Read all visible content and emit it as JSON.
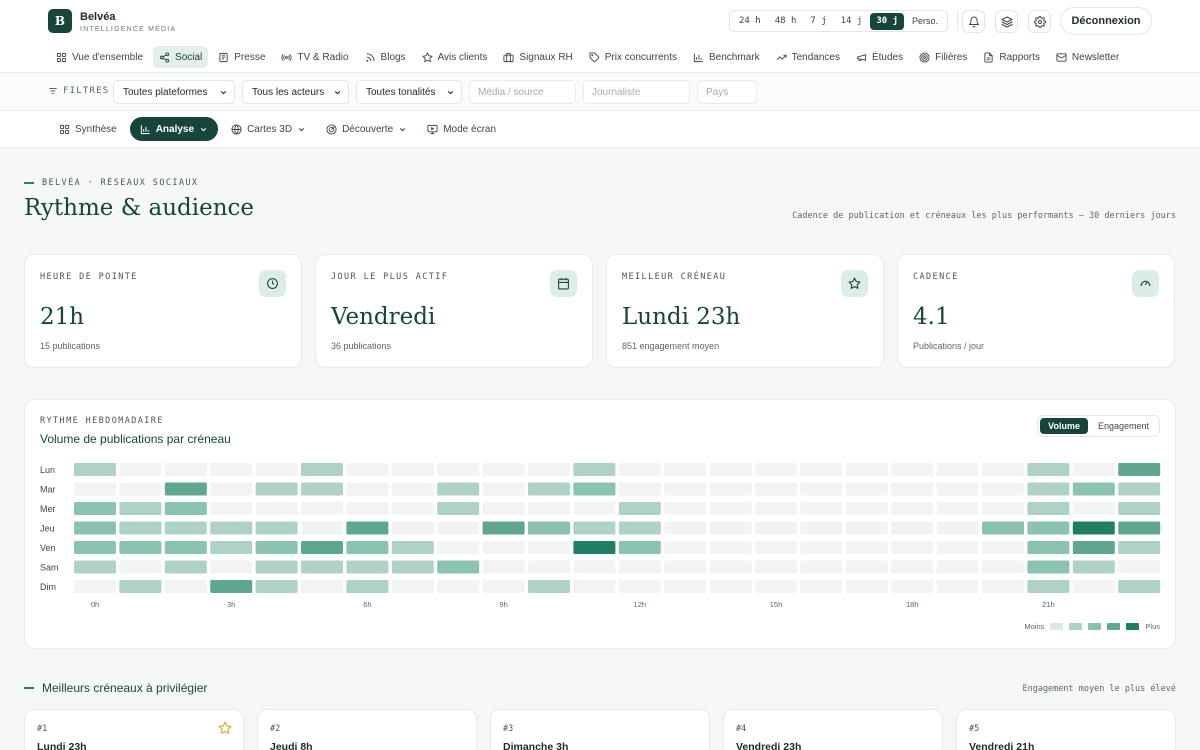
{
  "brand": {
    "logo_letter": "B",
    "name": "Belvéa",
    "tagline": "INTELLIGENCE MÉDIA"
  },
  "time_ranges": [
    {
      "label": "24 h",
      "active": false
    },
    {
      "label": "48 h",
      "active": false
    },
    {
      "label": "7 j",
      "active": false
    },
    {
      "label": "14 j",
      "active": false
    },
    {
      "label": "30 j",
      "active": true
    },
    {
      "label": "Perso.",
      "active": false
    }
  ],
  "header_actions": {
    "logout_label": "Déconnexion"
  },
  "nav": [
    {
      "label": "Vue d'ensemble",
      "icon": "grid-icon",
      "active": false
    },
    {
      "label": "Social",
      "icon": "share-icon",
      "active": true
    },
    {
      "label": "Presse",
      "icon": "newspaper-icon",
      "active": false
    },
    {
      "label": "TV & Radio",
      "icon": "broadcast-icon",
      "active": false
    },
    {
      "label": "Blogs",
      "icon": "rss-icon",
      "active": false
    },
    {
      "label": "Avis clients",
      "icon": "star-icon",
      "active": false
    },
    {
      "label": "Signaux RH",
      "icon": "briefcase-icon",
      "active": false
    },
    {
      "label": "Prix concurrents",
      "icon": "tag-icon",
      "active": false
    },
    {
      "label": "Benchmark",
      "icon": "bar-chart-icon",
      "active": false
    },
    {
      "label": "Tendances",
      "icon": "trend-icon",
      "active": false
    },
    {
      "label": "Études",
      "icon": "megaphone-icon",
      "active": false
    },
    {
      "label": "Filières",
      "icon": "target-icon",
      "active": false
    },
    {
      "label": "Rapports",
      "icon": "file-icon",
      "active": false
    },
    {
      "label": "Newsletter",
      "icon": "mail-icon",
      "active": false
    }
  ],
  "filters": {
    "label": "FILTRES",
    "platform": "Toutes plateformes",
    "actors": "Tous les acteurs",
    "tone": "Toutes tonalités",
    "media_placeholder": "Média / source",
    "journalist_placeholder": "Journaliste",
    "country_placeholder": "Pays"
  },
  "subnav": [
    {
      "label": "Synthèse",
      "icon": "grid-icon",
      "active": false,
      "chevron": false
    },
    {
      "label": "Analyse",
      "icon": "bar-chart-icon",
      "active": true,
      "chevron": true
    },
    {
      "label": "Cartes 3D",
      "icon": "globe-icon",
      "active": false,
      "chevron": true
    },
    {
      "label": "Découverte",
      "icon": "radar-icon",
      "active": false,
      "chevron": true
    },
    {
      "label": "Mode écran",
      "icon": "monitor-icon",
      "active": false,
      "chevron": false
    }
  ],
  "page": {
    "eyebrow": "BELVÉA · RÉSEAUX SOCIAUX",
    "title": "Rythme & audience",
    "description": "Cadence de publication et créneaux les plus performants — 30 derniers jours"
  },
  "kpis": [
    {
      "label": "HEURE DE POINTE",
      "value": "21h",
      "sub": "15 publications",
      "icon": "clock-icon"
    },
    {
      "label": "JOUR LE PLUS ACTIF",
      "value": "Vendredi",
      "sub": "36 publications",
      "icon": "calendar-icon"
    },
    {
      "label": "MEILLEUR CRÉNEAU",
      "value": "Lundi 23h",
      "sub": "851 engagement moyen",
      "icon": "star-icon"
    },
    {
      "label": "CADENCE",
      "value": "4.1",
      "sub": "Publications / jour",
      "icon": "gauge-icon"
    }
  ],
  "heatmap": {
    "eyebrow": "RYTHME HEBDOMADAIRE",
    "title": "Volume de publications par créneau",
    "toggle": [
      {
        "label": "Volume",
        "active": true
      },
      {
        "label": "Engagement",
        "active": false
      }
    ],
    "legend_less": "Moins",
    "legend_more": "Plus",
    "colors": [
      "#f1f4f3",
      "#dce6e3",
      "#afd2c6",
      "#8cc2b1",
      "#5fa78f",
      "#1e7f62"
    ]
  },
  "chart_data": {
    "type": "heatmap",
    "rows": [
      "Lun",
      "Mar",
      "Mer",
      "Jeu",
      "Ven",
      "Sam",
      "Dim"
    ],
    "columns": [
      "0h",
      "1h",
      "2h",
      "3h",
      "4h",
      "5h",
      "6h",
      "7h",
      "8h",
      "9h",
      "10h",
      "11h",
      "12h",
      "13h",
      "14h",
      "15h",
      "16h",
      "17h",
      "18h",
      "19h",
      "20h",
      "21h",
      "22h",
      "23h"
    ],
    "x_tick_labels": [
      {
        "column": 0,
        "label": "0h"
      },
      {
        "column": 3,
        "label": "3h"
      },
      {
        "column": 6,
        "label": "6h"
      },
      {
        "column": 9,
        "label": "9h"
      },
      {
        "column": 12,
        "label": "12h"
      },
      {
        "column": 15,
        "label": "15h"
      },
      {
        "column": 18,
        "label": "18h"
      },
      {
        "column": 21,
        "label": "21h"
      }
    ],
    "levels": [
      [
        2,
        0,
        0,
        0,
        0,
        2,
        0,
        0,
        0,
        0,
        0,
        2,
        0,
        0,
        0,
        0,
        0,
        0,
        0,
        0,
        0,
        2,
        0,
        4
      ],
      [
        0,
        0,
        4,
        0,
        2,
        2,
        0,
        0,
        2,
        0,
        2,
        3,
        0,
        0,
        0,
        0,
        0,
        0,
        0,
        0,
        0,
        2,
        3,
        2
      ],
      [
        3,
        2,
        3,
        0,
        0,
        0,
        0,
        0,
        2,
        0,
        0,
        0,
        2,
        0,
        0,
        0,
        0,
        0,
        0,
        0,
        0,
        2,
        0,
        2
      ],
      [
        3,
        2,
        2,
        2,
        2,
        0,
        4,
        0,
        0,
        4,
        3,
        2,
        2,
        0,
        0,
        0,
        0,
        0,
        0,
        0,
        3,
        3,
        5,
        4
      ],
      [
        3,
        3,
        3,
        2,
        3,
        4,
        3,
        2,
        0,
        0,
        0,
        5,
        3,
        0,
        0,
        0,
        0,
        0,
        0,
        0,
        0,
        3,
        4,
        2
      ],
      [
        2,
        0,
        2,
        0,
        2,
        2,
        2,
        2,
        3,
        0,
        0,
        0,
        0,
        0,
        0,
        0,
        0,
        0,
        0,
        0,
        0,
        3,
        2,
        0
      ],
      [
        0,
        2,
        0,
        4,
        2,
        0,
        2,
        0,
        0,
        0,
        2,
        0,
        0,
        0,
        0,
        0,
        0,
        0,
        0,
        0,
        0,
        2,
        0,
        2
      ]
    ],
    "scale": {
      "min_level": 0,
      "max_level": 5
    }
  },
  "best_slots": {
    "title": "Meilleurs créneaux à privilégier",
    "description": "Engagement moyen le plus élevé",
    "items": [
      {
        "rank": "#1",
        "label": "Lundi 23h",
        "starred": true
      },
      {
        "rank": "#2",
        "label": "Jeudi 8h",
        "starred": false
      },
      {
        "rank": "#3",
        "label": "Dimanche 3h",
        "starred": false
      },
      {
        "rank": "#4",
        "label": "Vendredi 23h",
        "starred": false
      },
      {
        "rank": "#5",
        "label": "Vendredi 21h",
        "starred": false
      }
    ]
  }
}
